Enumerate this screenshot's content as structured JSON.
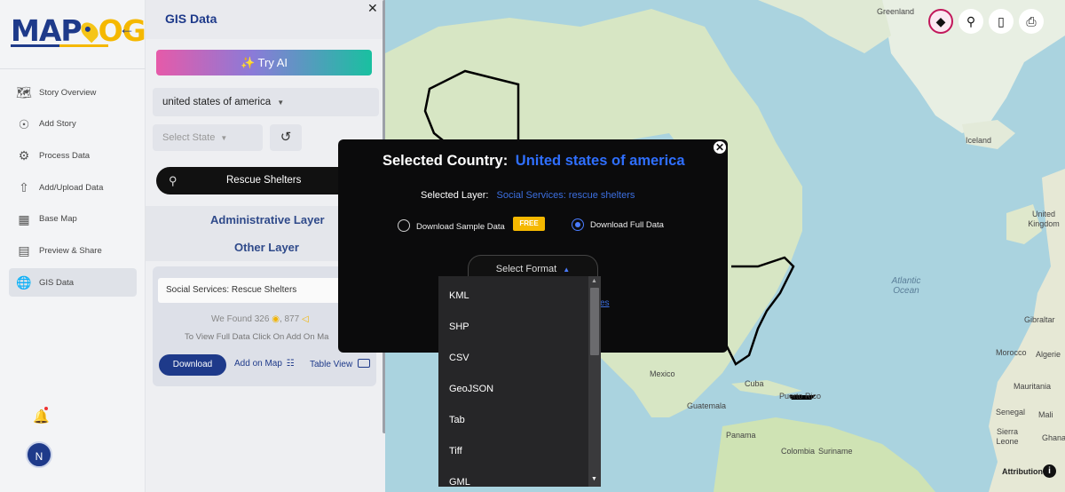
{
  "app": {
    "logo_part1": "MAP",
    "logo_part2": "OG"
  },
  "nav": {
    "items": [
      {
        "label": "Story Overview",
        "icon": "book-map-icon",
        "active": false
      },
      {
        "label": "Add Story",
        "icon": "location-pin-icon",
        "active": false
      },
      {
        "label": "Process Data",
        "icon": "process-data-icon",
        "active": false
      },
      {
        "label": "Add/Upload Data",
        "icon": "upload-icon",
        "active": false
      },
      {
        "label": "Base Map",
        "icon": "base-map-icon",
        "active": false
      },
      {
        "label": "Preview & Share",
        "icon": "preview-share-icon",
        "active": false
      },
      {
        "label": "GIS Data",
        "icon": "gis-data-icon",
        "active": true
      }
    ],
    "avatar_initial": "N"
  },
  "panel": {
    "title": "GIS Data",
    "try_ai_label": "Try AI",
    "country_value": "united states of america",
    "state_placeholder": "Select State",
    "search_value": "Rescue Shelters",
    "admin_layer_label": "Administrative Layer",
    "other_layer_label": "Other Layer",
    "result": {
      "layer_name": "Social Services: Rescue Shelters",
      "found_prefix": "We Found",
      "point_count": "326",
      "polygon_count": "877",
      "hint": "To View Full Data Click On Add On Ma",
      "download_label": "Download",
      "add_on_map_label": "Add on Map",
      "table_view_label": "Table View"
    }
  },
  "map": {
    "labels": [
      {
        "text": "Greenland"
      },
      {
        "text": "Iceland"
      },
      {
        "text": "United Kingdom"
      },
      {
        "text": "Atlantic Ocean"
      },
      {
        "text": "Gibraltar"
      },
      {
        "text": "Morocco"
      },
      {
        "text": "Algerie"
      },
      {
        "text": "Mauritania"
      },
      {
        "text": "Senegal"
      },
      {
        "text": "Mali"
      },
      {
        "text": "Sierra Leone"
      },
      {
        "text": "Ghana"
      },
      {
        "text": "Mexico"
      },
      {
        "text": "Cuba"
      },
      {
        "text": "Puerto Rico"
      },
      {
        "text": "Guatemala"
      },
      {
        "text": "Panama"
      },
      {
        "text": "Colombia"
      },
      {
        "text": "Suriname"
      }
    ],
    "attribution": "Attribution"
  },
  "modal": {
    "country_label": "Selected Country:",
    "country_value": "United states of america",
    "layer_label": "Selected Layer:",
    "layer_value": "Social Services: rescue shelters",
    "option_sample": "Download Sample Data",
    "free_badge": "FREE",
    "option_full": "Download Full Data",
    "selected_option": "full",
    "format_button": "Select Format",
    "link_fragment": "es",
    "formats": [
      "KML",
      "SHP",
      "CSV",
      "GeoJSON",
      "Tab",
      "Tiff",
      "GML"
    ]
  },
  "colors": {
    "brand_blue": "#1e3a8a",
    "accent_yellow": "#f5b800",
    "link_blue": "#2f6fff",
    "modal_bg": "#0b0b0c"
  }
}
